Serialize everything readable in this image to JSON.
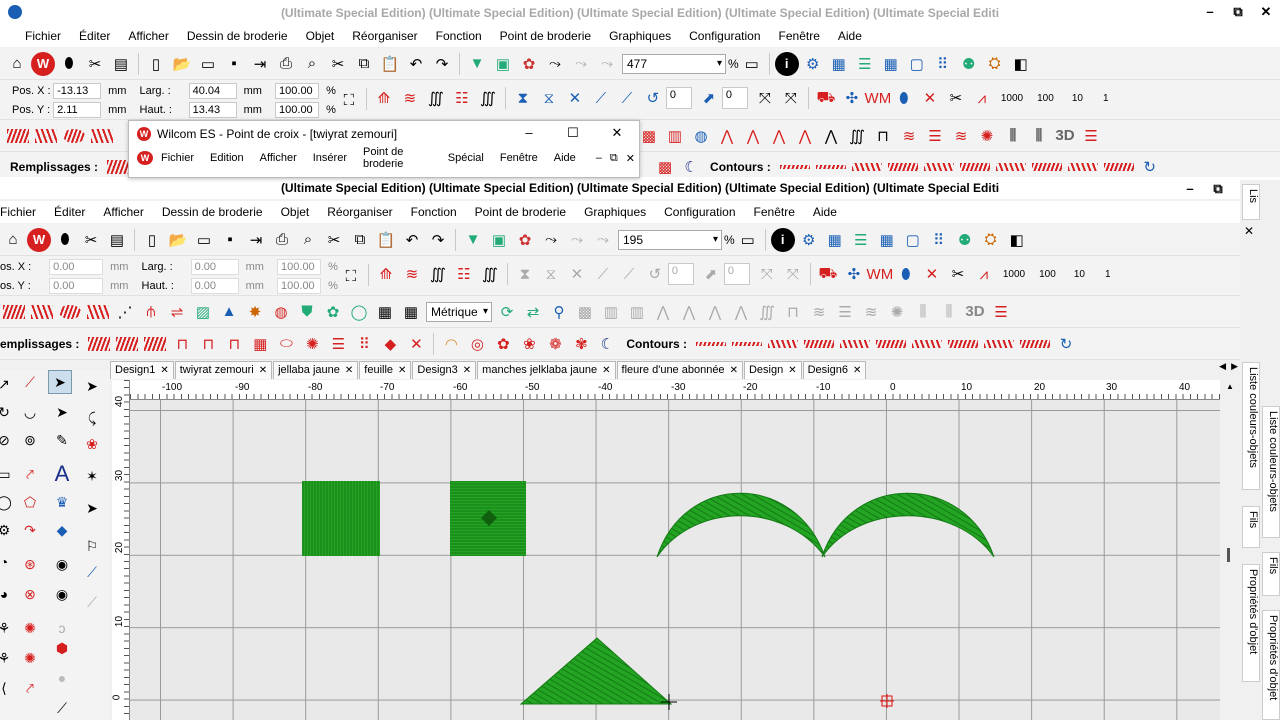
{
  "main_window": {
    "title": "(Ultimate Special Edition) (Ultimate Special Edition) (Ultimate Special Edition) (Ultimate Special Edition) (Ultimate Special Editi",
    "menu": [
      "Fichier",
      "Éditer",
      "Afficher",
      "Dessin de broderie",
      "Objet",
      "Réorganiser",
      "Fonction",
      "Point de broderie",
      "Graphiques",
      "Configuration",
      "Fenêtre",
      "Aide"
    ],
    "zoom": "477",
    "percent": "%",
    "pos_x_label": "Pos. X :",
    "pos_x": "-13.13",
    "pos_y_label": "Pos. Y :",
    "pos_y": "2.11",
    "larg_label": "Larg. :",
    "larg": "40.04",
    "haut_label": "Haut. :",
    "haut": "13.43",
    "unit": "mm",
    "pct1": "100.00",
    "pct2": "100.00",
    "spin1": "0",
    "spin2": "0",
    "num1000": "1000",
    "num100": "100",
    "num10": "10",
    "num1": "1",
    "remplissages": "Remplissages :",
    "contours": "Contours :"
  },
  "sub_window": {
    "title": "Wilcom ES - Point de croix - [twiyrat zemouri]",
    "menu": [
      "Fichier",
      "Edition",
      "Afficher",
      "Insérer",
      "Point de broderie",
      "Spécial",
      "Fenêtre",
      "Aide"
    ]
  },
  "doc_window": {
    "title": "(Ultimate Special Edition) (Ultimate Special Edition) (Ultimate Special Edition) (Ultimate Special Edition) (Ultimate Special Editi",
    "menu": [
      "Fichier",
      "Éditer",
      "Afficher",
      "Dessin de broderie",
      "Objet",
      "Réorganiser",
      "Fonction",
      "Point de broderie",
      "Graphiques",
      "Configuration",
      "Fenêtre",
      "Aide"
    ],
    "zoom": "195",
    "pos_x_label": "os. X :",
    "pos_x": "0.00",
    "pos_y_label": "os. Y :",
    "pos_y": "0.00",
    "larg_label": "Larg. :",
    "larg": "0.00",
    "haut_label": "Haut. :",
    "haut": "0.00",
    "unit": "mm",
    "pct1": "100.00",
    "pct2": "100.00",
    "spin1": "0",
    "spin2": "0",
    "metrique": "Métrique",
    "label_3d": "3D",
    "remplissages": "emplissages :",
    "contours": "Contours :"
  },
  "tabs": [
    "Design1",
    "twiyrat zemouri",
    "jellaba jaune",
    "feuille",
    "Design3",
    "manches jelklaba jaune",
    "fleure d'une abonnée",
    "Design",
    "Design6"
  ],
  "ruler_h": [
    "-100",
    "-90",
    "-80",
    "-70",
    "-60",
    "-50",
    "-40",
    "-30",
    "-20",
    "-10",
    "0",
    "10",
    "20",
    "30",
    "40"
  ],
  "ruler_v": [
    "40",
    "30",
    "20",
    "10",
    "0"
  ],
  "side_tabs": [
    "Lis",
    "Liste couleurs-objets",
    "Fils",
    "Propriétés d'objet"
  ],
  "side_tabs_right": [
    "Liste couleurs-objets",
    "Fils",
    "Propriétés d'objet"
  ],
  "colors": {
    "stitch_green": "#1fa31f",
    "accent_red": "#d62020"
  }
}
